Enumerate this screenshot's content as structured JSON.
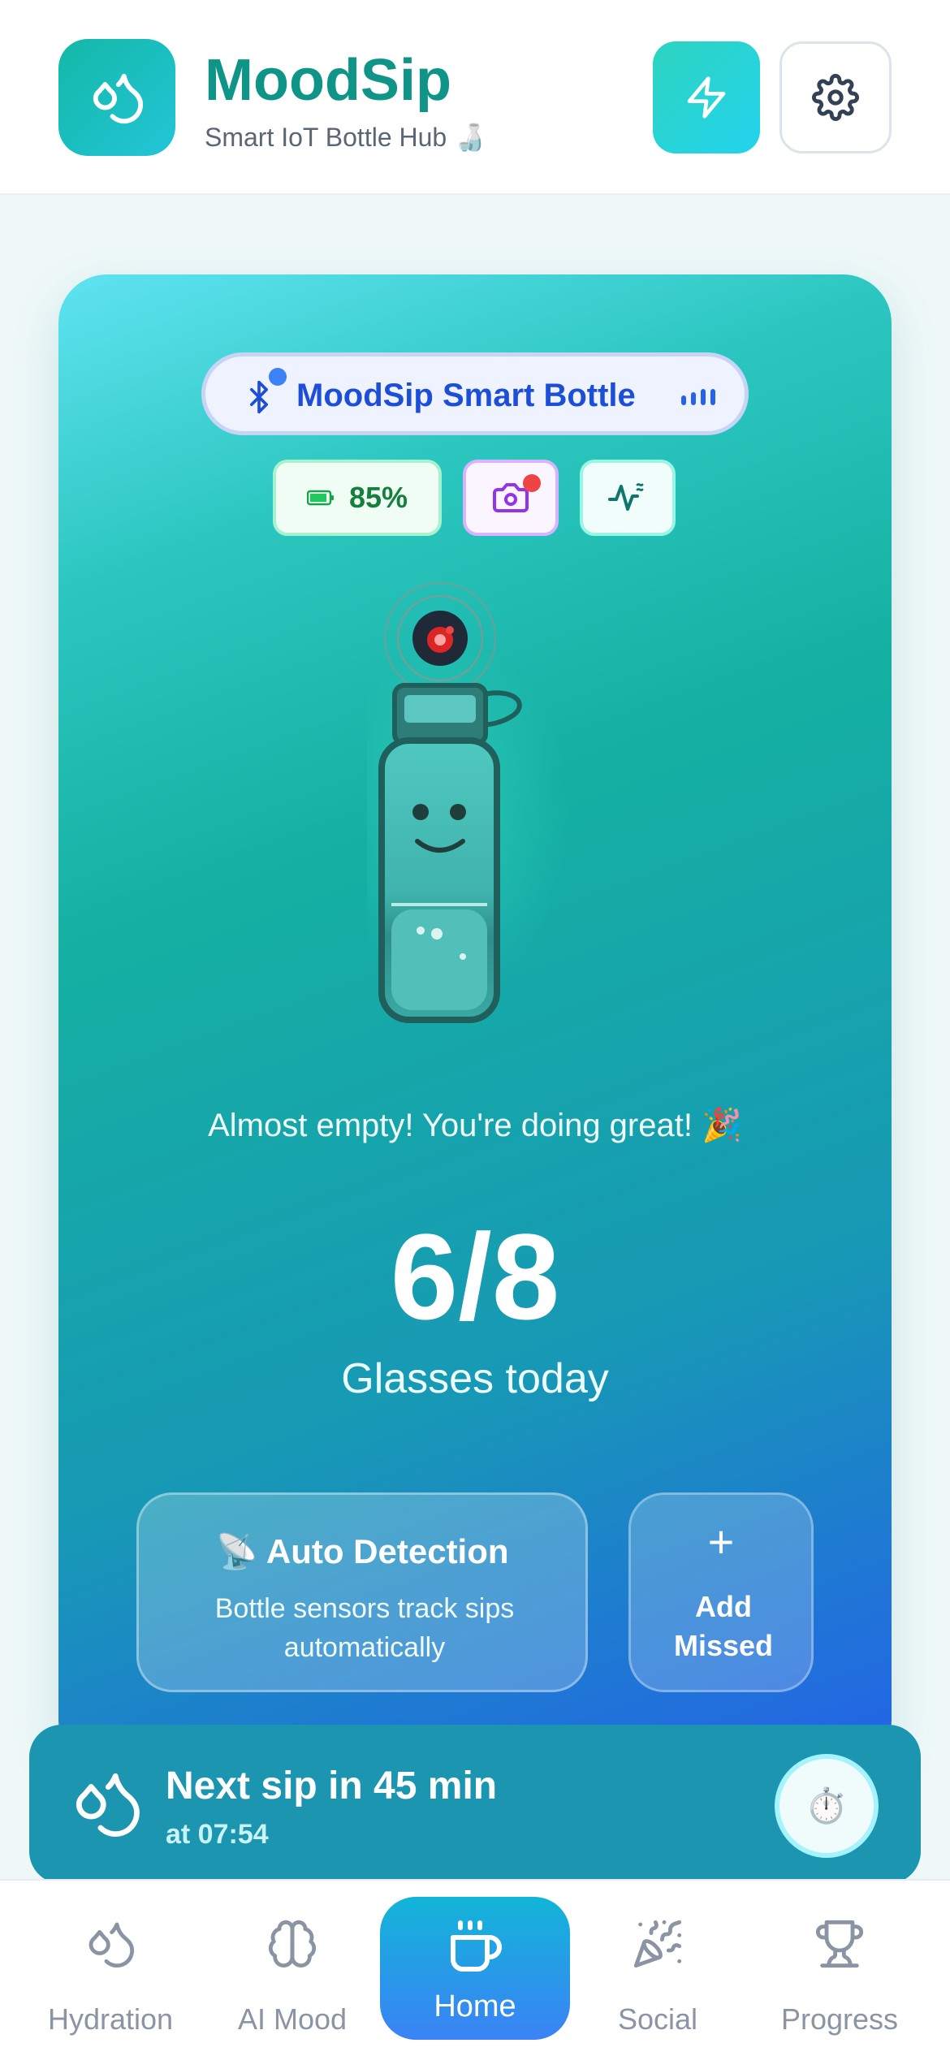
{
  "header": {
    "title": "MoodSip",
    "subtitle": "Smart IoT Bottle Hub 🍶",
    "logo_icon": "water-drops-icon",
    "action_icon": "lightning-bolt-icon",
    "settings_icon": "gear-icon",
    "accent_color": "#0f9488"
  },
  "device": {
    "name": "MoodSip Smart Bottle",
    "connection_icon": "bluetooth-icon",
    "battery": "85%",
    "camera_icon": "camera-icon",
    "activity_icon": "activity-wave-icon"
  },
  "hydration": {
    "status_message": "Almost empty! You're doing great! 🎉",
    "count": "6/8",
    "count_label": "Glasses today",
    "glasses_consumed": 6,
    "glasses_goal": 8
  },
  "auto_detection": {
    "title": "📡 Auto Detection",
    "description": "Bottle sensors track sips automatically"
  },
  "add_missed": {
    "icon": "+",
    "label": "Add Missed"
  },
  "next_sip": {
    "title": "Next sip in 45 min",
    "time": "at 07:54",
    "timer_icon": "⏱️"
  },
  "nav": {
    "items": [
      {
        "label": "Hydration",
        "icon": "water-drops-icon"
      },
      {
        "label": "AI Mood",
        "icon": "brain-icon"
      },
      {
        "label": "Home",
        "icon": "cup-icon",
        "active": true
      },
      {
        "label": "Social",
        "icon": "party-popper-icon"
      },
      {
        "label": "Progress",
        "icon": "trophy-icon"
      }
    ]
  }
}
